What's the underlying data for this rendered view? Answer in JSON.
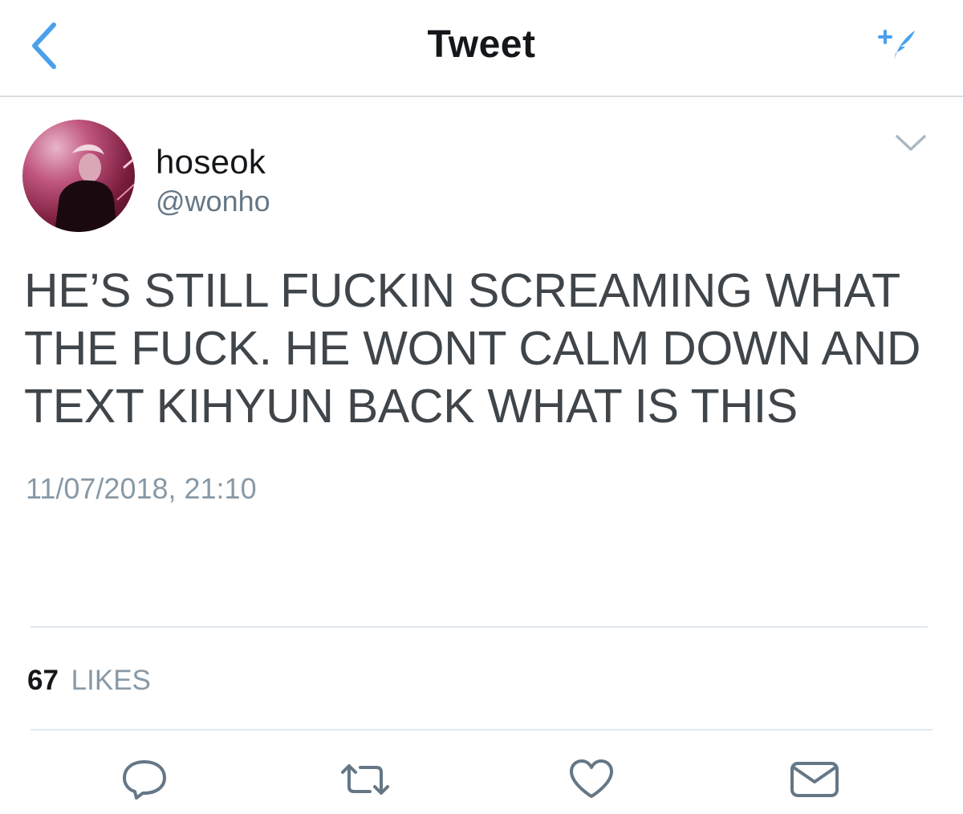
{
  "header": {
    "title": "Tweet",
    "back_icon": "chevron-left-icon",
    "compose_icon": "compose-feather-icon",
    "accent_color": "#4aa0ec"
  },
  "tweet": {
    "author": {
      "name": "hoseok",
      "handle": "@wonho"
    },
    "text": "HE’S STILL FUCKIN SCREAMING WHAT THE FUCK. HE WONT CALM DOWN AND TEXT KIHYUN BACK WHAT IS THIS",
    "timestamp": "11/07/2018, 21:10",
    "likes": {
      "count": "67",
      "label": "LIKES"
    }
  },
  "actions": [
    {
      "name": "reply",
      "icon": "reply-bubble-icon"
    },
    {
      "name": "retweet",
      "icon": "retweet-icon"
    },
    {
      "name": "like",
      "icon": "heart-icon"
    },
    {
      "name": "direct-message",
      "icon": "envelope-icon"
    }
  ]
}
